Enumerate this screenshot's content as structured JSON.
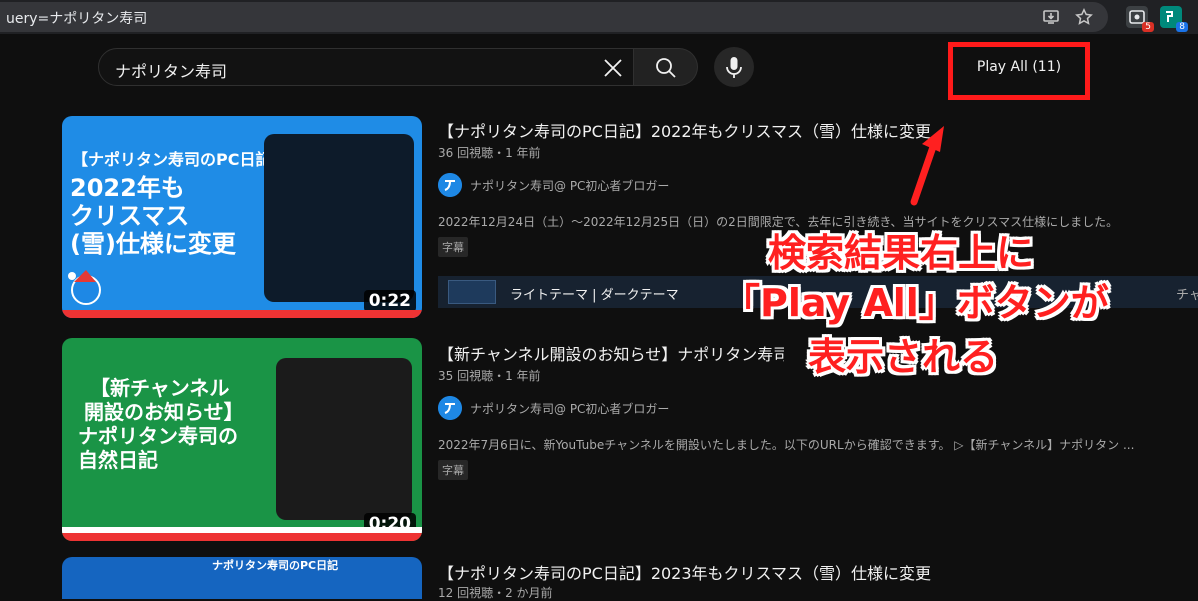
{
  "browser": {
    "url_text": "uery=ナポリタン寿司",
    "ext_badges": [
      "5",
      "8"
    ]
  },
  "search": {
    "query": "ナポリタン寿司"
  },
  "play_all_label": "Play All (11)",
  "videos": [
    {
      "title": "【ナポリタン寿司のPC日記】2022年もクリスマス（雪）仕様に変更",
      "meta": "36 回視聴・1 年前",
      "channel": "ナポリタン寿司@ PC初心者ブロガー",
      "description": "2022年12月24日（土）～2022年12月25日（日）の2日間限定で、去年に引き続き、当サイトをクリスマス仕様にしました。",
      "badge": "字幕",
      "duration": "0:22",
      "thumb_lines": [
        "【ナポリタン寿司のPC日記】",
        "2022年も",
        "クリスマス",
        "(雪)仕様に変更"
      ],
      "chapter_label": "ライトテーマ | ダークテーマ",
      "chapter_right": "チャ"
    },
    {
      "title": "【新チャンネル開設のお知らせ】ナポリタン寿司の自然日記",
      "meta": "35 回視聴・1 年前",
      "channel": "ナポリタン寿司@ PC初心者ブロガー",
      "description": "2022年7月6日に、新YouTubeチャンネルを開設いたしました。以下のURLから確認できます。 ▷【新チャンネル】ナポリタン ...",
      "badge": "字幕",
      "duration": "0:20",
      "thumb_lines": [
        "【新チャンネル",
        "開設のお知らせ】",
        "ナポリタン寿司の",
        "自然日記"
      ]
    },
    {
      "title": "【ナポリタン寿司のPC日記】2023年もクリスマス（雪）仕様に変更",
      "meta": "12 回視聴・2 か月前",
      "thumb_lines": [
        "ナポリタン寿司のPC日記"
      ]
    }
  ],
  "annotation": {
    "lines": [
      "検索結果右上に",
      "「Play All」ボタンが",
      "表示される"
    ]
  },
  "colors": {
    "annotation_red": "#ff2020",
    "highlight_box": "#ff1a1a"
  }
}
